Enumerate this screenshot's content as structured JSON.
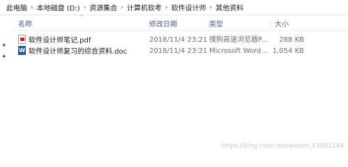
{
  "breadcrumb": [
    "此电脑",
    "本地磁盘 (D:)",
    "资源集合",
    "计算机软考",
    "软件设计师",
    "其他资料"
  ],
  "columns": {
    "name": "名称",
    "date": "修改日期",
    "type": "类型",
    "size": "大小"
  },
  "files": [
    {
      "name": "软件设计师笔记.pdf",
      "date": "2018/11/4 23:21",
      "type": "搜狗高速浏览器P...",
      "size": "288 KB",
      "icon": "pdf-file-icon"
    },
    {
      "name": "软件设计师复习的综合资料.doc",
      "date": "2018/11/4 23:21",
      "type": "Microsoft Word ...",
      "size": "1,054 KB",
      "icon": "word-file-icon"
    }
  ],
  "watermark": "https://blog.csdn.net/weixin_43993284"
}
